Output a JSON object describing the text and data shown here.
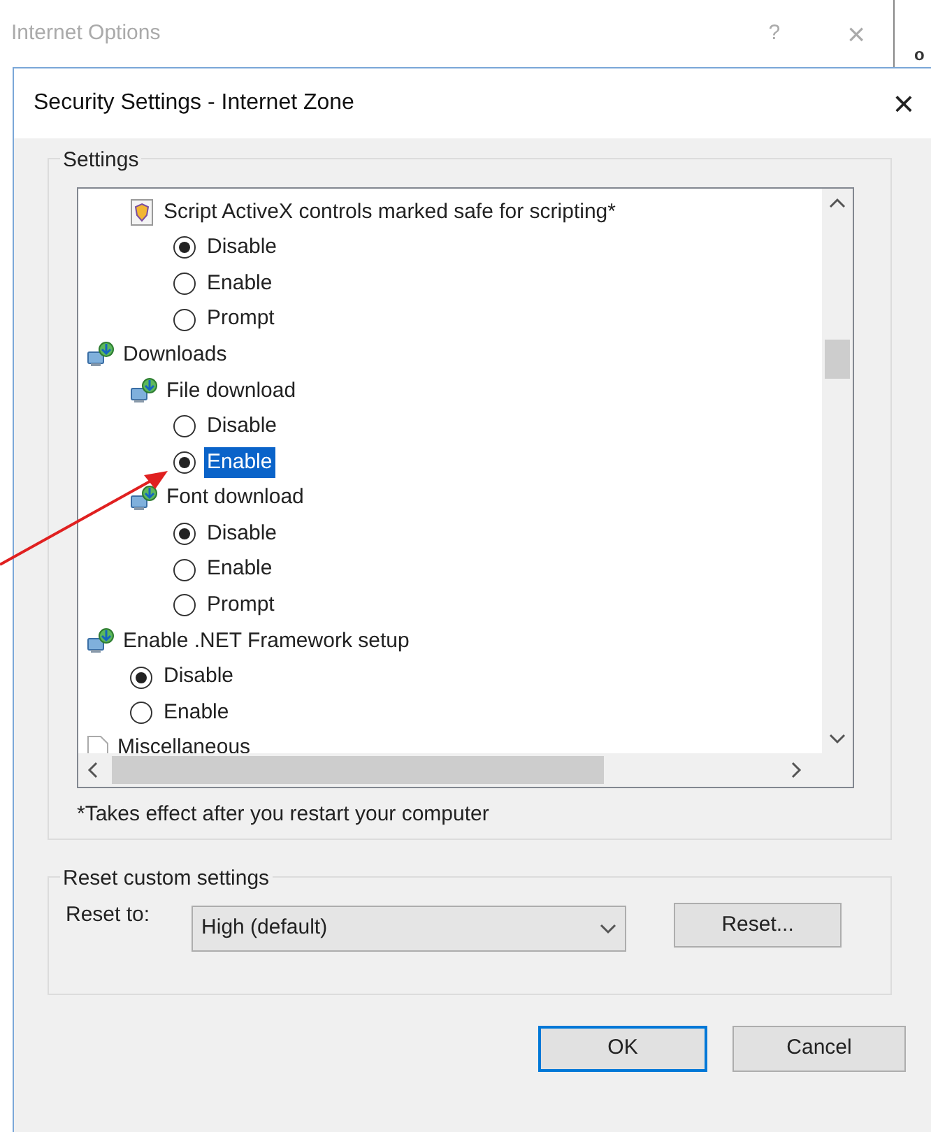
{
  "background_window": {
    "title": "Internet Options",
    "help": "?",
    "close": "×",
    "edge_text": "o"
  },
  "dialog": {
    "title": "Security Settings - Internet Zone",
    "close": "×"
  },
  "settings": {
    "legend": "Settings",
    "continued": [
      {
        "kind": "activex",
        "label": "Script ActiveX controls marked safe for scripting*",
        "children": [
          {
            "kind": "option",
            "label": "Disable",
            "selected": true,
            "focused": false
          },
          {
            "kind": "option",
            "label": "Enable",
            "selected": false,
            "focused": false
          },
          {
            "kind": "option",
            "label": "Prompt",
            "selected": false,
            "focused": false
          }
        ]
      }
    ],
    "items": [
      {
        "kind": "setting",
        "label": "Downloads",
        "children": [
          {
            "kind": "setting",
            "label": "File download",
            "children": [
              {
                "kind": "option",
                "label": "Disable",
                "selected": false,
                "focused": false
              },
              {
                "kind": "option",
                "label": "Enable",
                "selected": true,
                "focused": true
              }
            ]
          },
          {
            "kind": "setting",
            "label": "Font download",
            "children": [
              {
                "kind": "option",
                "label": "Disable",
                "selected": true,
                "focused": false
              },
              {
                "kind": "option",
                "label": "Enable",
                "selected": false,
                "focused": false
              },
              {
                "kind": "option",
                "label": "Prompt",
                "selected": false,
                "focused": false
              }
            ]
          }
        ]
      },
      {
        "kind": "setting",
        "label": "Enable .NET Framework setup",
        "children": [
          {
            "kind": "option",
            "label": "Disable",
            "selected": true,
            "focused": false
          },
          {
            "kind": "option",
            "label": "Enable",
            "selected": false,
            "focused": false
          }
        ]
      },
      {
        "kind": "page",
        "label": "Miscellaneous"
      }
    ],
    "footnote": "*Takes effect after you restart your computer"
  },
  "reset": {
    "legend": "Reset custom settings",
    "label": "Reset to:",
    "value": "High (default)",
    "button": "Reset..."
  },
  "buttons": [
    {
      "label": "OK",
      "default": true
    },
    {
      "label": "Cancel",
      "default": false
    }
  ]
}
